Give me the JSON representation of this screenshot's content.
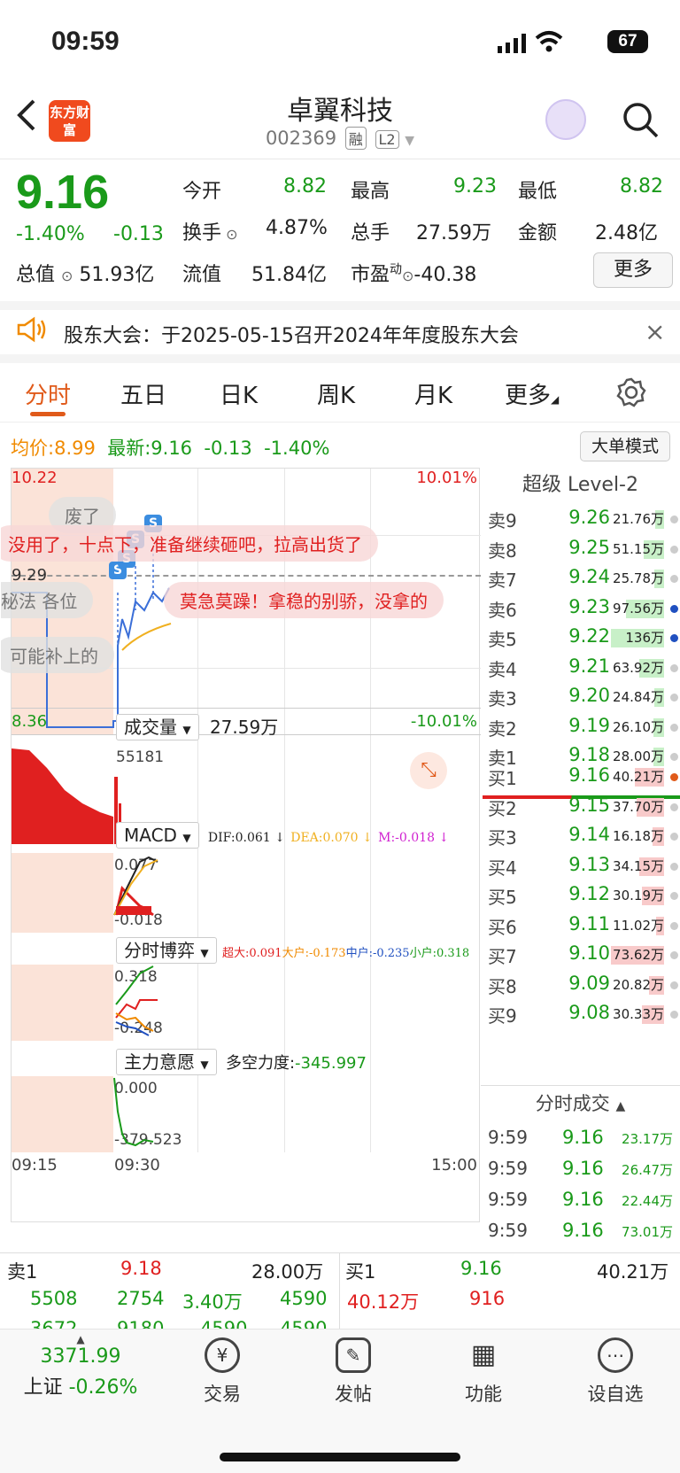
{
  "status": {
    "time": "09:59",
    "battery": "67"
  },
  "nav": {
    "logo": "东方财富",
    "title": "卓翼科技",
    "code": "002369",
    "tag1": "融",
    "tag2": "L2"
  },
  "quote": {
    "price": "9.16",
    "pct": "-1.40%",
    "chg": "-0.13",
    "open_label": "今开",
    "open": "8.82",
    "high_label": "最高",
    "high": "9.23",
    "low_label": "最低",
    "low": "8.82",
    "turnover_label": "换手",
    "turnover": "4.87%",
    "vol_label": "总手",
    "vol": "27.59万",
    "amt_label": "金额",
    "amt": "2.48亿",
    "mcap_label": "总值",
    "mcap": "51.93亿",
    "float_label": "流值",
    "float": "51.84亿",
    "pe_label": "市盈",
    "pe_sup": "动",
    "pe": "-40.38",
    "more": "更多"
  },
  "notice": {
    "text": "股东大会：于2025-05-15召开2024年年度股东大会",
    "close": "×"
  },
  "tabs": [
    "分时",
    "五日",
    "日K",
    "周K",
    "月K",
    "更多"
  ],
  "chart": {
    "avg_label": "均价:",
    "avg": "8.99",
    "latest_label": "最新:",
    "latest": "9.16",
    "latest_chg": "-0.13",
    "latest_pct": "-1.40%",
    "bigorder": "大单模式",
    "top_price": "10.22",
    "top_pct": "10.01%",
    "bot_price": "8.36",
    "bot_pct": "-10.01%",
    "mid_price": "9.29",
    "vol_label": "成交量",
    "vol_value": "27.59万",
    "vol_max": "55181",
    "macd_label": "MACD",
    "dif": "DIF:0.061 ↓",
    "dea": "DEA:0.070 ↓",
    "m": "M:-0.018 ↓",
    "macd_top": "0.077",
    "macd_bot": "-0.018",
    "game_label": "分时博弈",
    "super": "超大:0.091",
    "large": "大户:-0.173",
    "mid": "中户:-0.235",
    "small": "小户:0.318",
    "game_top": "0.318",
    "game_bot": "-0.248",
    "will_label": "主力意愿",
    "power": "多空力度:",
    "power_val": "-345.997",
    "will_top": "0.000",
    "will_bot": "-379.523",
    "t_start": "09:15",
    "t_open": "09:30",
    "t_end": "15:00"
  },
  "comments": [
    "废了",
    "没用了，十点下，准备继续砸吧，拉高出货了",
    "莫急莫躁！拿稳的别骄，没拿的",
    "秘法 各位",
    "可能补上的"
  ],
  "orderbook": {
    "title": "超级 Level-2",
    "asks": [
      {
        "label": "卖9",
        "price": "9.26",
        "vol": "21.76万"
      },
      {
        "label": "卖8",
        "price": "9.25",
        "vol": "51.15万"
      },
      {
        "label": "卖7",
        "price": "9.24",
        "vol": "25.78万"
      },
      {
        "label": "卖6",
        "price": "9.23",
        "vol": "97.56万"
      },
      {
        "label": "卖5",
        "price": "9.22",
        "vol": "136万"
      },
      {
        "label": "卖4",
        "price": "9.21",
        "vol": "63.92万"
      },
      {
        "label": "卖3",
        "price": "9.20",
        "vol": "24.84万"
      },
      {
        "label": "卖2",
        "price": "9.19",
        "vol": "26.10万"
      },
      {
        "label": "卖1",
        "price": "9.18",
        "vol": "28.00万"
      }
    ],
    "bids": [
      {
        "label": "买1",
        "price": "9.16",
        "vol": "40.21万"
      },
      {
        "label": "买2",
        "price": "9.15",
        "vol": "37.70万"
      },
      {
        "label": "买3",
        "price": "9.14",
        "vol": "16.18万"
      },
      {
        "label": "买4",
        "price": "9.13",
        "vol": "34.15万"
      },
      {
        "label": "买5",
        "price": "9.12",
        "vol": "30.19万"
      },
      {
        "label": "买6",
        "price": "9.11",
        "vol": "11.02万"
      },
      {
        "label": "买7",
        "price": "9.10",
        "vol": "73.62万"
      },
      {
        "label": "买8",
        "price": "9.09",
        "vol": "20.82万"
      },
      {
        "label": "买9",
        "price": "9.08",
        "vol": "30.33万"
      }
    ],
    "ticks_title": "分时成交",
    "ticks": [
      {
        "time": "9:59",
        "price": "9.16",
        "vol": "23.17万"
      },
      {
        "time": "9:59",
        "price": "9.16",
        "vol": "26.47万"
      },
      {
        "time": "9:59",
        "price": "9.16",
        "vol": "22.44万"
      },
      {
        "time": "9:59",
        "price": "9.16",
        "vol": "73.01万"
      }
    ]
  },
  "bottom": {
    "sell_label": "卖1",
    "sell_price": "9.18",
    "sell_vol": "28.00万",
    "buy_label": "买1",
    "buy_price": "9.16",
    "buy_vol": "40.21万",
    "row1": [
      "5508",
      "2754",
      "3.40万",
      "4590",
      "40.12万",
      "916"
    ],
    "row2": [
      "3672",
      "9180",
      "4590",
      "4590"
    ]
  },
  "tabbar": {
    "index_value": "3371.99",
    "index_name": "上证",
    "index_pct": "-0.26%",
    "items": [
      "交易",
      "发帖",
      "功能",
      "设自选"
    ]
  }
}
